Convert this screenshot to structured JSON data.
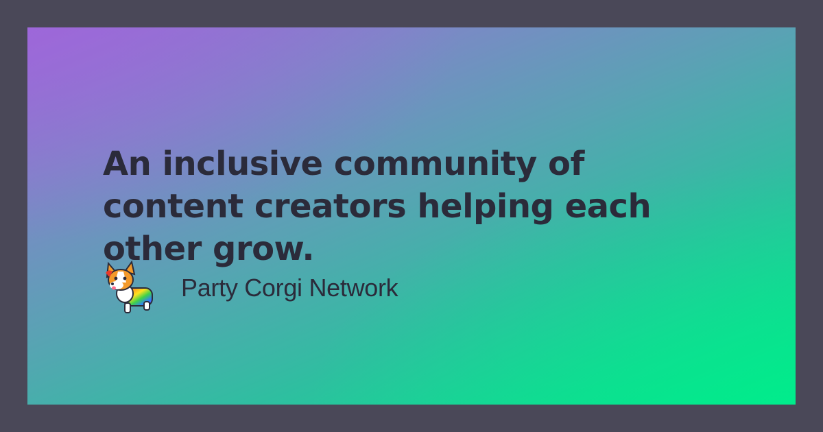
{
  "card": {
    "headline": "An inclusive community of content creators helping each other grow.",
    "brand": {
      "name": "Party Corgi Network",
      "logo_icon": "rainbow-corgi-icon"
    }
  },
  "colors": {
    "frame": "#4a4858",
    "gradient_start": "#9a6bd6",
    "gradient_end": "#00e88a",
    "text": "#2b2b3a"
  }
}
